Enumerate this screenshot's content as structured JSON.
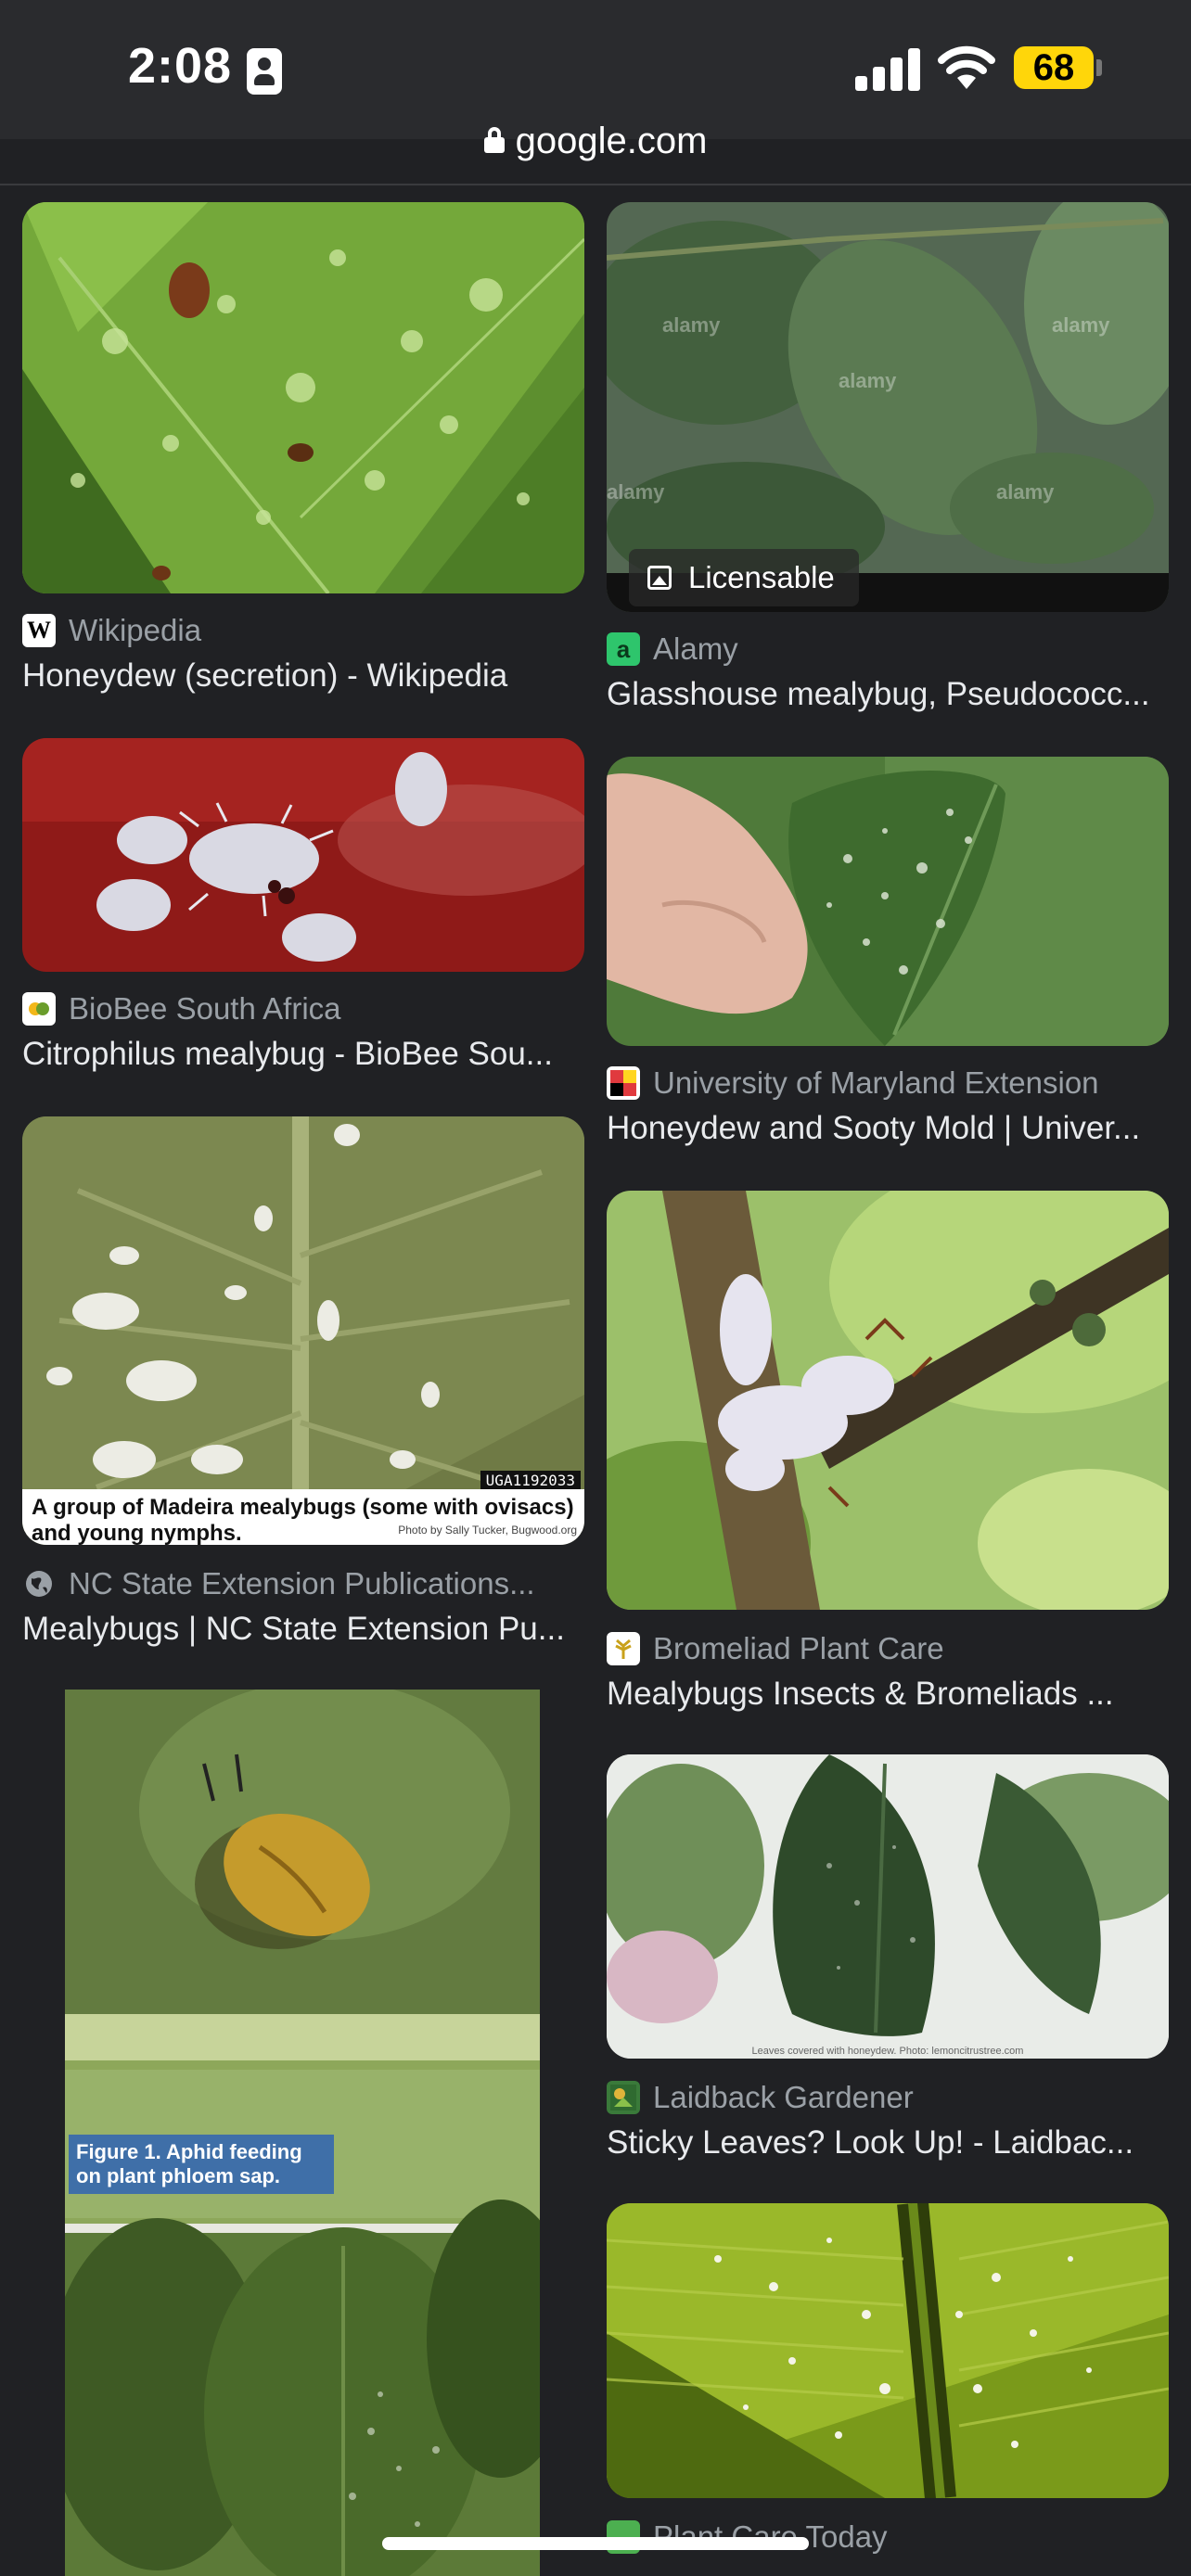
{
  "status": {
    "time": "2:08",
    "battery": "68"
  },
  "browser": {
    "url": "google.com"
  },
  "results": {
    "left": [
      {
        "source": "Wikipedia",
        "title": "Honeydew (secretion) - Wikipedia",
        "favicon": "W"
      },
      {
        "source": "BioBee South Africa",
        "title": "Citrophilus mealybug - BioBee Sou..."
      },
      {
        "source": "NC State Extension Publications...",
        "title": "Mealybugs | NC State Extension Pu...",
        "caption": "A group of Madeira mealybugs (some with ovisacs) and young nymphs.",
        "credit": "Photo by Sally Tucker, Bugwood.org",
        "code": "UGA1192033"
      },
      {
        "caption": "Figure 1. Aphid feeding on plant phloem sap."
      }
    ],
    "right": [
      {
        "source": "Alamy",
        "title": "Glasshouse mealybug, Pseudococc...",
        "favicon": "a",
        "badge": "Licensable",
        "watermark": "alamy"
      },
      {
        "source": "University of Maryland Extension",
        "title": "Honeydew and Sooty Mold | Univer..."
      },
      {
        "source": "Bromeliad Plant Care",
        "title": "Mealybugs Insects & Bromeliads ..."
      },
      {
        "source": "Laidback Gardener",
        "title": "Sticky Leaves? Look Up! - Laidbac...",
        "caption": "Leaves covered with honeydew. Photo: lemoncitrustree.com"
      },
      {
        "source": "Plant Care Today",
        "title": ""
      }
    ]
  },
  "colors": {
    "background": "#202124",
    "source_text": "#9aa0a6",
    "title_text": "#e8eaed",
    "battery": "#ffd60a"
  }
}
